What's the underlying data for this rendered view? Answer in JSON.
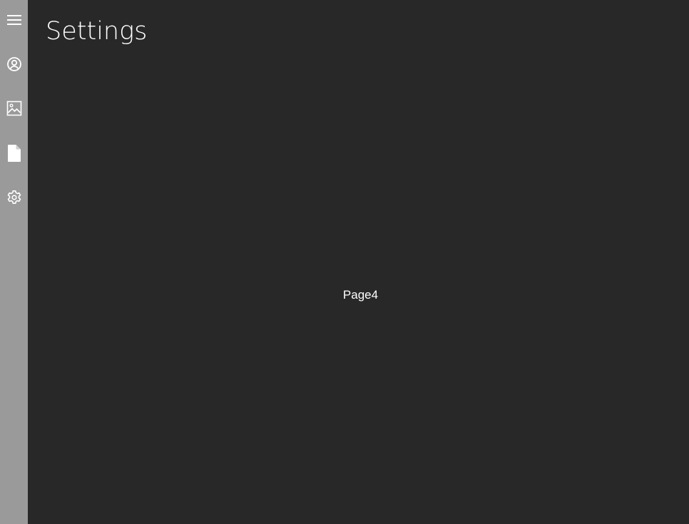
{
  "page": {
    "title": "Settings",
    "content": "Page4"
  },
  "sidebar": {
    "items": [
      {
        "icon": "menu-icon"
      },
      {
        "icon": "account-circle-icon"
      },
      {
        "icon": "image-icon"
      },
      {
        "icon": "document-icon"
      },
      {
        "icon": "settings-gear-icon"
      }
    ]
  },
  "colors": {
    "sidebar_background": "#9a9a9a",
    "main_background": "#282828",
    "icon_color": "#ffffff",
    "text_color": "#ffffff"
  }
}
